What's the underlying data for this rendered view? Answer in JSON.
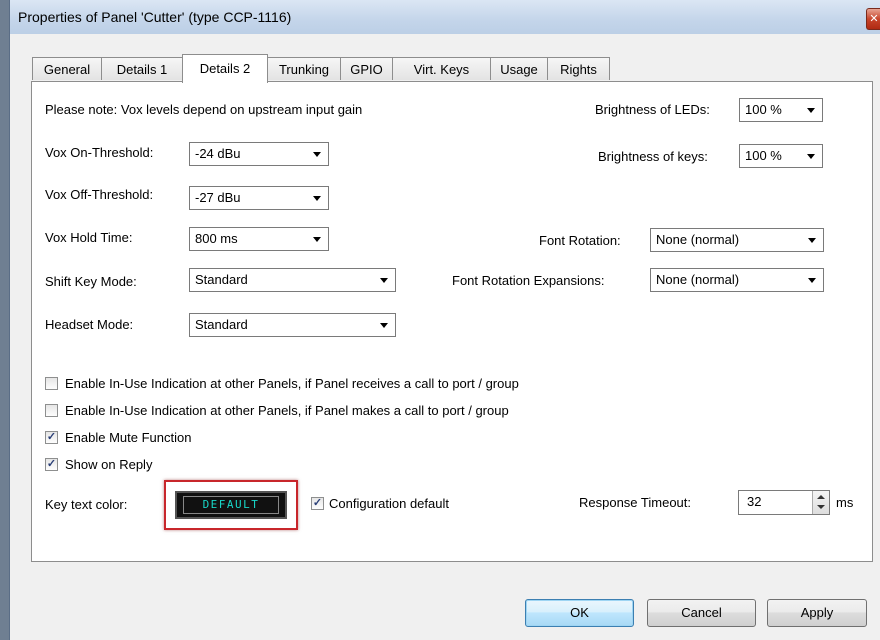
{
  "window": {
    "title": "Properties of Panel 'Cutter' (type CCP-1116)",
    "close_symbol": "✕"
  },
  "tabs": [
    "General",
    "Details 1",
    "Details 2",
    "Trunking",
    "GPIO",
    "Virt. Keys",
    "Usage",
    "Rights"
  ],
  "active_tab": "Details 2",
  "note": "Please note: Vox levels depend on upstream input gain",
  "fields": {
    "vox_on": {
      "label": "Vox On-Threshold:",
      "value": "-24 dBu"
    },
    "vox_off": {
      "label": "Vox Off-Threshold:",
      "value": "-27 dBu"
    },
    "vox_hold": {
      "label": "Vox Hold Time:",
      "value": "800 ms"
    },
    "shift_key": {
      "label": "Shift Key Mode:",
      "value": "Standard"
    },
    "headset": {
      "label": "Headset Mode:",
      "value": "Standard"
    },
    "led_brightness": {
      "label": "Brightness of LEDs:",
      "value": "100 %"
    },
    "key_brightness": {
      "label": "Brightness of keys:",
      "value": "100 %"
    },
    "font_rotation": {
      "label": "Font Rotation:",
      "value": "None (normal)"
    },
    "font_rotation_exp": {
      "label": "Font Rotation Expansions:",
      "value": "None (normal)"
    }
  },
  "checkboxes": [
    {
      "label": "Enable In-Use Indication at other Panels, if Panel receives a call to port / group",
      "checked": false
    },
    {
      "label": "Enable In-Use Indication at other Panels, if Panel makes a call to port / group",
      "checked": false
    },
    {
      "label": "Enable Mute Function",
      "checked": true
    },
    {
      "label": "Show on Reply",
      "checked": true
    }
  ],
  "key_text_color": {
    "label": "Key text color:",
    "button_text": "DEFAULT",
    "text_color": "#18d6c8"
  },
  "config_default": {
    "label": "Configuration default",
    "checked": true
  },
  "response_timeout": {
    "label": "Response Timeout:",
    "value": "32",
    "unit": "ms"
  },
  "buttons": {
    "ok": "OK",
    "cancel": "Cancel",
    "apply": "Apply"
  },
  "colors": {
    "highlight_border": "#c8262b",
    "default_button_border": "#3c7fb1",
    "title_bar": "#c4d5ea"
  }
}
